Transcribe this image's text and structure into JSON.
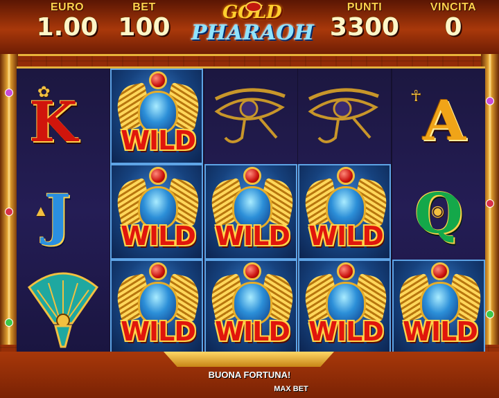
{
  "hud": {
    "euro": {
      "label": "EURO",
      "value": "1.00"
    },
    "bet": {
      "label": "BET",
      "value": "100"
    },
    "punti": {
      "label": "PUNTI",
      "value": "3300"
    },
    "vincita": {
      "label": "VINCITA",
      "value": "0"
    }
  },
  "logo": {
    "line1": "GOLD",
    "line2": "PHARAOH"
  },
  "reels": {
    "wild_label": "WILD",
    "symbols": {
      "k": "K",
      "a": "A",
      "j": "J",
      "q": "Q"
    }
  },
  "footer": {
    "message": "BUONA FORTUNA!",
    "max_bet": "MAX BET"
  },
  "colors": {
    "gold": "#ffd34d",
    "wild_red": "#e0160c",
    "reel_blue": "#16427e"
  }
}
